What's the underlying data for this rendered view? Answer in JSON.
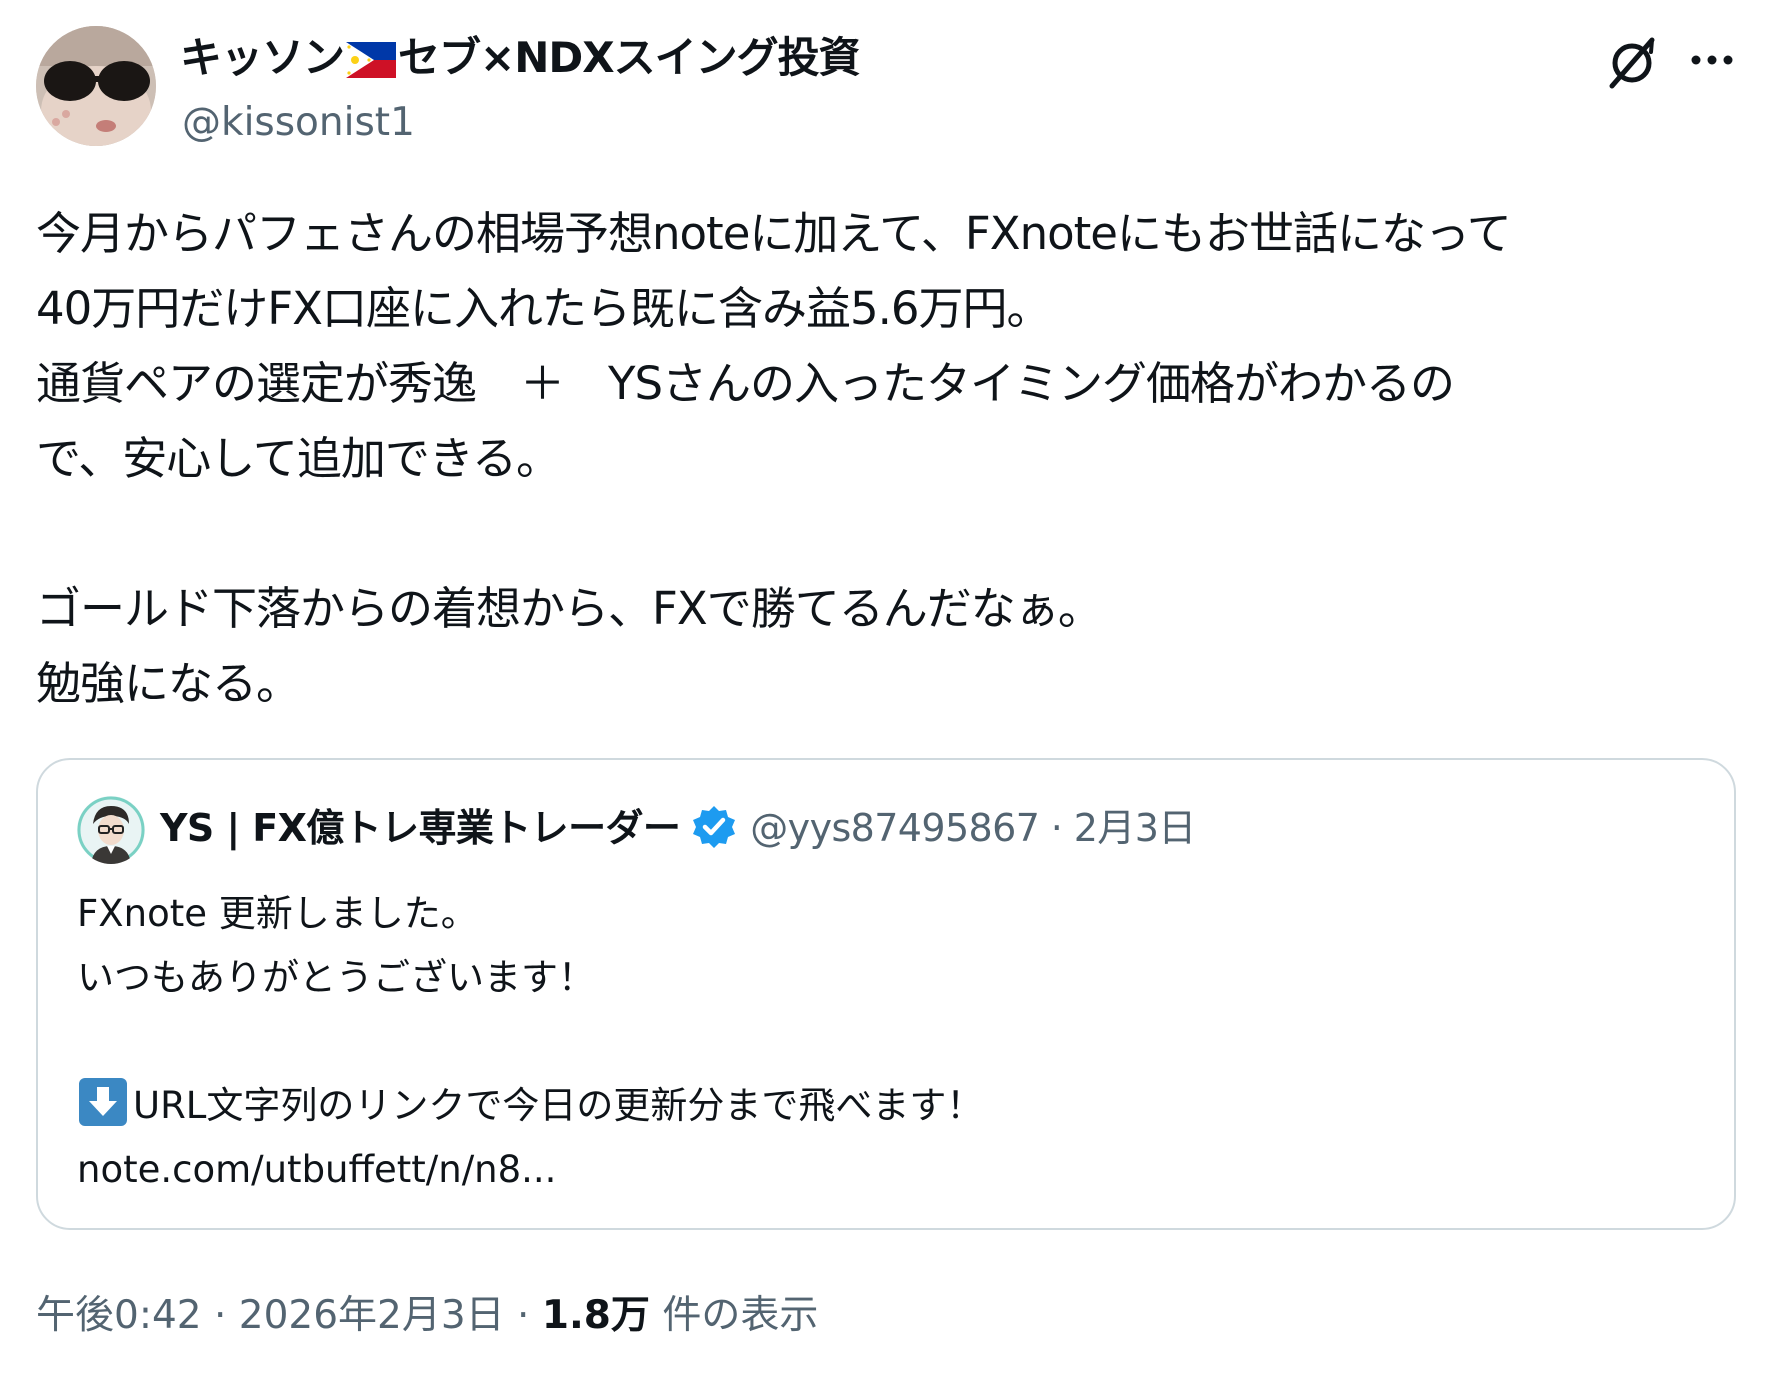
{
  "author": {
    "display_name": "キッソン🇵🇭セブ×NDXスイング投資",
    "display_name_pre": "キッソン",
    "display_name_post": "セブ×NDXスイング投資",
    "flag_icon": "philippines-flag-icon",
    "handle": "@kissonist1",
    "avatar_icon": "avatar-sunglasses"
  },
  "header_icons": {
    "grok": "grok-icon",
    "more": "more-icon"
  },
  "tweet": {
    "text": "今月からパフェさんの相場予想noteに加えて、FXnoteにもお世話になって\n40万円だけFX口座に入れたら既に含み益5.6万円。\n通貨ペアの選定が秀逸　＋　YSさんの入ったタイミング価格がわかるの\nで、安心して追加できる。\n\nゴールド下落からの着想から、FXで勝てるんだなぁ。\n勉強になる。"
  },
  "quote": {
    "display_name": "YS | FX億トレ専業トレーダー",
    "verified_icon": "verified-badge-icon",
    "handle": "@yys87495867",
    "date": "· 2月3日",
    "line1": "FXnote 更新しました。",
    "line2": "いつもありがとうございます！",
    "line3": "URL文字列のリンクで今日の更新分まで飛べます！",
    "line3_icon": "down-arrow-emoji-icon",
    "link": "note.com/utbuffett/n/n8..."
  },
  "footer": {
    "time": "午後0:42 · 2026年2月3日 · ",
    "views_count": "1.8万",
    "views_label": " 件の表示"
  },
  "colors": {
    "text": "#0f1419",
    "secondary": "#536471",
    "border": "#cfd9de",
    "verified": "#1d9bf0"
  }
}
